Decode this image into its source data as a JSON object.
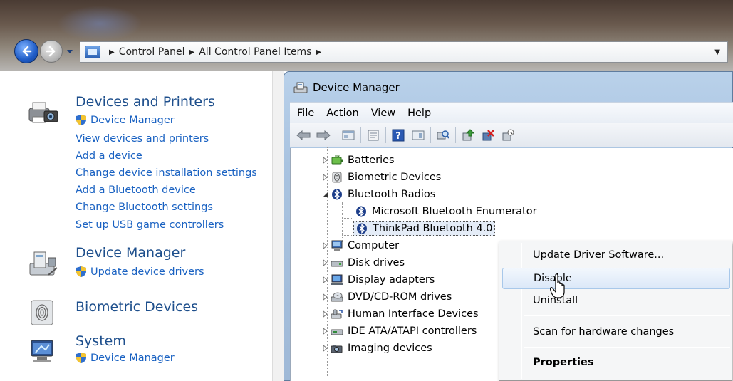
{
  "address_bar": {
    "crumbs": [
      "Control Panel",
      "All Control Panel Items"
    ]
  },
  "control_panel": {
    "devices_printers": {
      "title": "Devices and Printers",
      "links": [
        "Device Manager",
        "View devices and printers",
        "Add a device",
        "Change device installation settings",
        "Add a Bluetooth device",
        "Change Bluetooth settings",
        "Set up USB game controllers"
      ]
    },
    "device_manager": {
      "title": "Device Manager",
      "links": [
        "Update device drivers"
      ]
    },
    "biometric": {
      "title": "Biometric Devices"
    },
    "system": {
      "title": "System",
      "links": [
        "Device Manager"
      ]
    }
  },
  "device_manager_window": {
    "title": "Device Manager",
    "menu": [
      "File",
      "Action",
      "View",
      "Help"
    ],
    "tree": [
      {
        "label": "Batteries",
        "icon": "battery-icon",
        "state": "collapsed"
      },
      {
        "label": "Biometric Devices",
        "icon": "fingerprint-icon",
        "state": "collapsed"
      },
      {
        "label": "Bluetooth Radios",
        "icon": "bluetooth-icon",
        "state": "expanded"
      },
      {
        "label": "Microsoft Bluetooth Enumerator",
        "icon": "bluetooth-icon",
        "state": "child"
      },
      {
        "label": "ThinkPad Bluetooth 4.0",
        "icon": "bluetooth-icon",
        "state": "child-selected"
      },
      {
        "label": "Computer",
        "icon": "computer-icon",
        "state": "collapsed"
      },
      {
        "label": "Disk drives",
        "icon": "disk-drive-icon",
        "state": "collapsed"
      },
      {
        "label": "Display adapters",
        "icon": "display-adapter-icon",
        "state": "collapsed"
      },
      {
        "label": "DVD/CD-ROM drives",
        "icon": "dvd-drive-icon",
        "state": "collapsed"
      },
      {
        "label": "Human Interface Devices",
        "icon": "hid-icon",
        "state": "collapsed"
      },
      {
        "label": "IDE ATA/ATAPI controllers",
        "icon": "ide-controller-icon",
        "state": "collapsed"
      },
      {
        "label": "Imaging devices",
        "icon": "camera-icon",
        "state": "collapsed"
      }
    ]
  },
  "context_menu": {
    "items": [
      "Update Driver Software...",
      "Disable",
      "Uninstall",
      "Scan for hardware changes",
      "Properties"
    ],
    "hovered": "Disable"
  },
  "colors": {
    "link": "#1a62c2",
    "title": "#1e4f8c",
    "bluetooth": "#1d3e8a"
  }
}
